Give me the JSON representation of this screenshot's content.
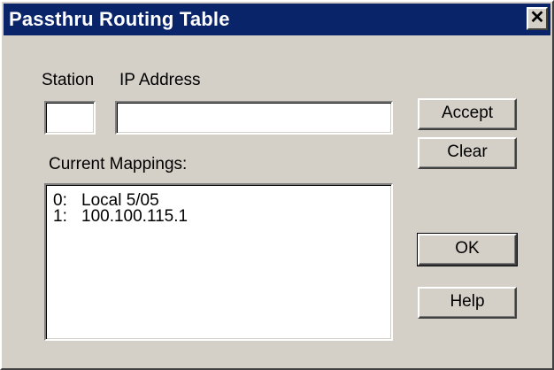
{
  "window": {
    "title": "Passthru Routing Table",
    "close_glyph": "✕",
    "close_icon": "close-icon"
  },
  "form": {
    "station_label": "Station",
    "ip_label": "IP Address",
    "station_value": "",
    "ip_value": "",
    "mappings_label": "Current Mappings:"
  },
  "mappings": [
    {
      "index": "0:",
      "value": "Local 5/05"
    },
    {
      "index": "1:",
      "value": "100.100.115.1"
    }
  ],
  "buttons": {
    "accept": "Accept",
    "clear": "Clear",
    "ok": "OK",
    "help": "Help"
  },
  "colors": {
    "titlebar": "#0a246a",
    "face": "#d4d0c8"
  }
}
